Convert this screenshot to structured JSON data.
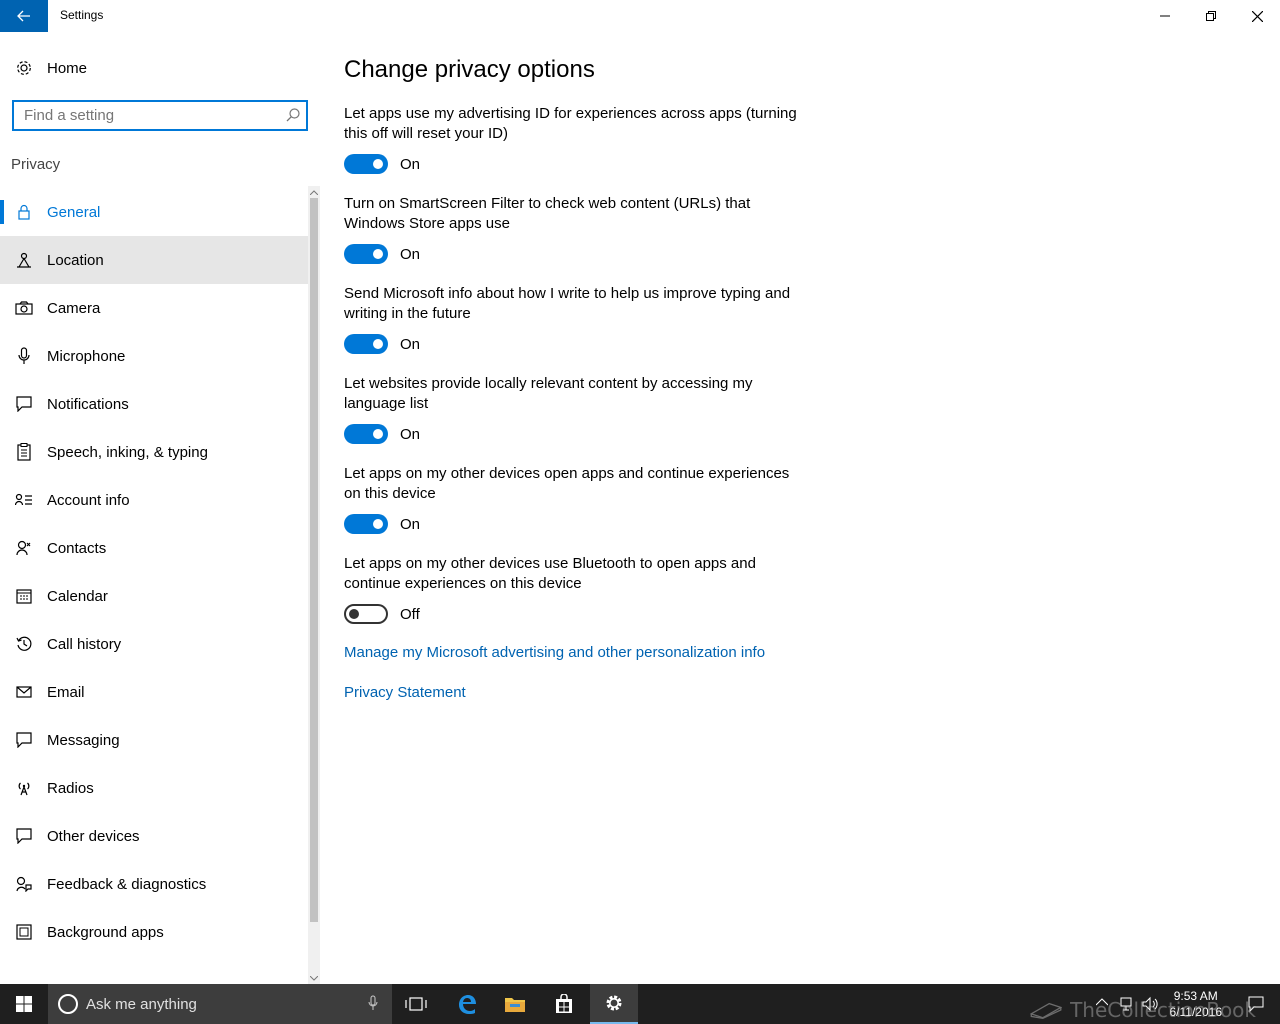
{
  "window": {
    "title": "Settings"
  },
  "nav": {
    "home_label": "Home",
    "search_placeholder": "Find a setting",
    "section_label": "Privacy",
    "items": [
      {
        "label": "General",
        "icon": "lock-icon"
      },
      {
        "label": "Location",
        "icon": "location-icon"
      },
      {
        "label": "Camera",
        "icon": "camera-icon"
      },
      {
        "label": "Microphone",
        "icon": "microphone-icon"
      },
      {
        "label": "Notifications",
        "icon": "notifications-icon"
      },
      {
        "label": "Speech, inking, & typing",
        "icon": "speech-icon"
      },
      {
        "label": "Account info",
        "icon": "account-info-icon"
      },
      {
        "label": "Contacts",
        "icon": "contacts-icon"
      },
      {
        "label": "Calendar",
        "icon": "calendar-icon"
      },
      {
        "label": "Call history",
        "icon": "call-history-icon"
      },
      {
        "label": "Email",
        "icon": "email-icon"
      },
      {
        "label": "Messaging",
        "icon": "messaging-icon"
      },
      {
        "label": "Radios",
        "icon": "radios-icon"
      },
      {
        "label": "Other devices",
        "icon": "other-devices-icon"
      },
      {
        "label": "Feedback & diagnostics",
        "icon": "feedback-icon"
      },
      {
        "label": "Background apps",
        "icon": "background-apps-icon"
      }
    ],
    "selected": "General",
    "hovered": "Location"
  },
  "content": {
    "title": "Change privacy options",
    "options": [
      {
        "text": "Let apps use my advertising ID for experiences across apps (turning this off will reset your ID)",
        "state": "On"
      },
      {
        "text": "Turn on SmartScreen Filter to check web content (URLs) that Windows Store apps use",
        "state": "On"
      },
      {
        "text": "Send Microsoft info about how I write to help us improve typing and writing in the future",
        "state": "On"
      },
      {
        "text": "Let websites provide locally relevant content by accessing my language list",
        "state": "On"
      },
      {
        "text": "Let apps on my other devices open apps and continue experiences on this device",
        "state": "On"
      },
      {
        "text": "Let apps on my other devices use Bluetooth to open apps and continue experiences on this device",
        "state": "Off"
      }
    ],
    "links": [
      "Manage my Microsoft advertising and other personalization info",
      "Privacy Statement"
    ]
  },
  "taskbar": {
    "search_placeholder": "Ask me anything",
    "time": "9:53 AM",
    "date": "6/11/2016",
    "watermark": "TheCollectionBook"
  },
  "colors": {
    "accent": "#0078d7",
    "link": "#0063b1",
    "back_button": "#0063b1"
  }
}
